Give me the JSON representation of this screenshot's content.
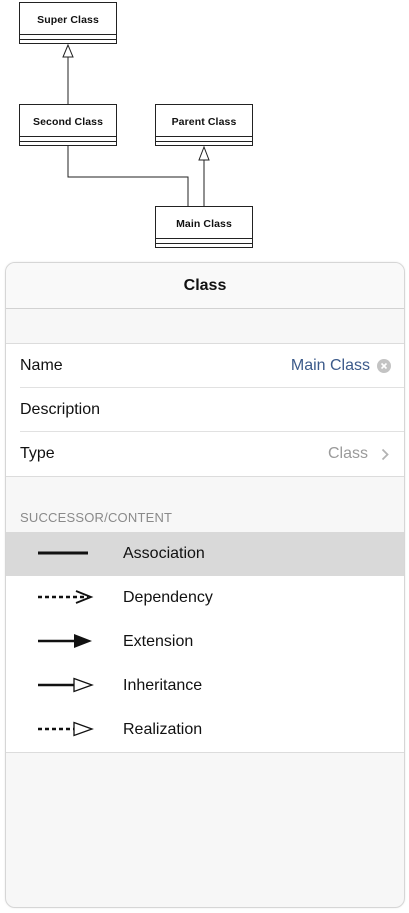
{
  "diagram": {
    "boxes": {
      "super": "Super Class",
      "second": "Second Class",
      "parent": "Parent Class",
      "main": "Main Class"
    }
  },
  "panel": {
    "title": "Class",
    "fields": {
      "name_label": "Name",
      "name_value": "Main Class",
      "description_label": "Description",
      "type_label": "Type",
      "type_value": "Class"
    },
    "section_header": "SUCCESSOR/CONTENT",
    "connectors": [
      {
        "label": "Association",
        "icon": "association-line-icon",
        "selected": true
      },
      {
        "label": "Dependency",
        "icon": "dependency-arrow-icon",
        "selected": false
      },
      {
        "label": "Extension",
        "icon": "extension-arrow-icon",
        "selected": false
      },
      {
        "label": "Inheritance",
        "icon": "inheritance-arrow-icon",
        "selected": false
      },
      {
        "label": "Realization",
        "icon": "realization-arrow-icon",
        "selected": false
      }
    ]
  },
  "colors": {
    "value_blue": "#3c5a8a",
    "muted_gray": "#9a9a9a",
    "selected_row": "#d9d9d9"
  }
}
